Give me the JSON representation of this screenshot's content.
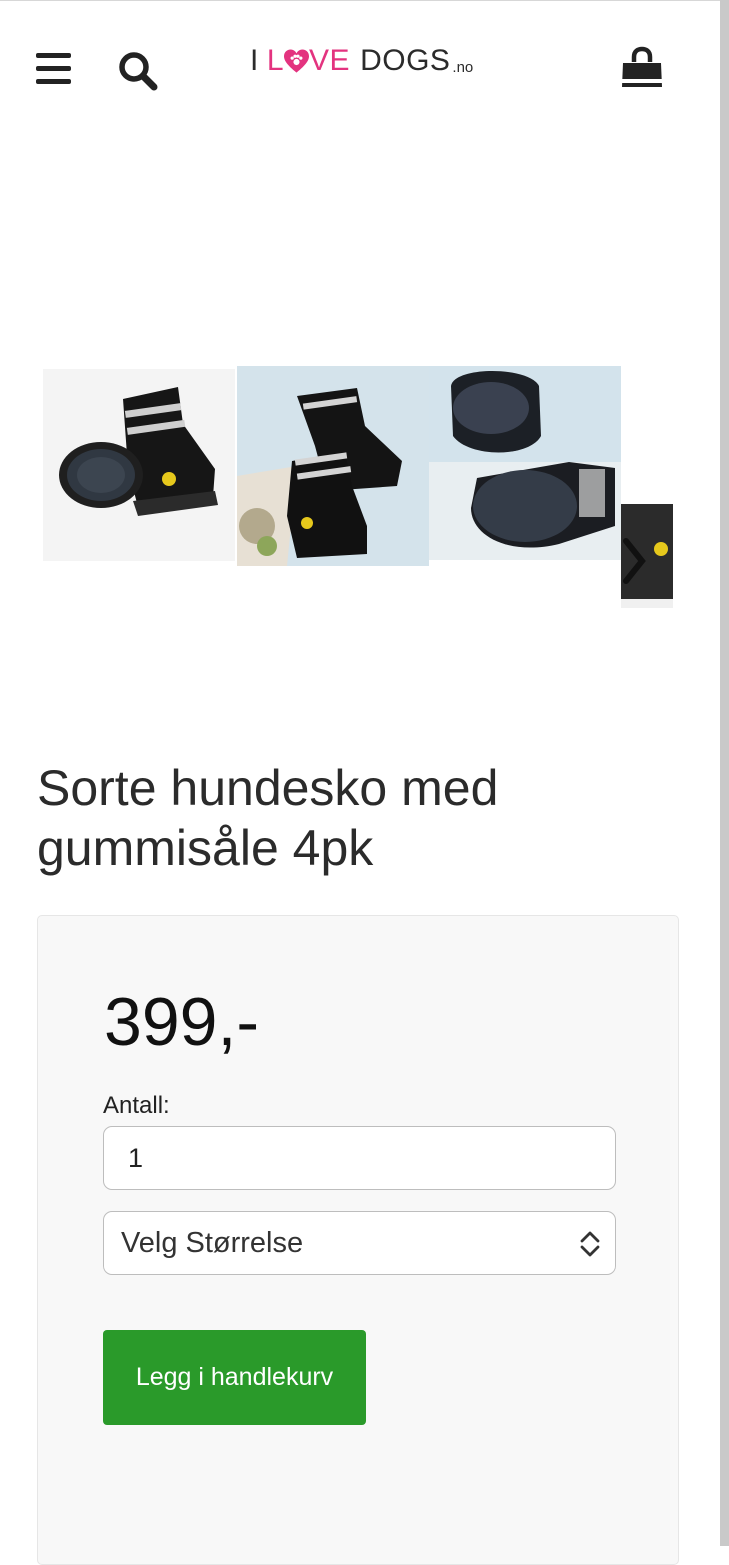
{
  "header": {
    "logo": {
      "word1": "I",
      "word2_l": "L",
      "word2_rest": "VE",
      "word3": "DOGS",
      "tld": ".no"
    },
    "icons": {
      "menu": "hamburger-menu-icon",
      "search": "search-icon",
      "cart": "shopping-bag-icon"
    }
  },
  "gallery": {
    "images": [
      "product-image-1",
      "product-image-2",
      "product-image-3",
      "product-image-4"
    ],
    "next_icon": "chevron-right-icon"
  },
  "product": {
    "title": "Sorte hundesko med gummisåle 4pk",
    "price": "399,-",
    "quantity_label": "Antall:",
    "quantity_value": "1",
    "size_select": "Velg Størrelse",
    "add_to_cart": "Legg i handlekurv"
  },
  "colors": {
    "accent": "#e3337f",
    "button": "#2a9a2a",
    "text": "#2b2b2b"
  }
}
